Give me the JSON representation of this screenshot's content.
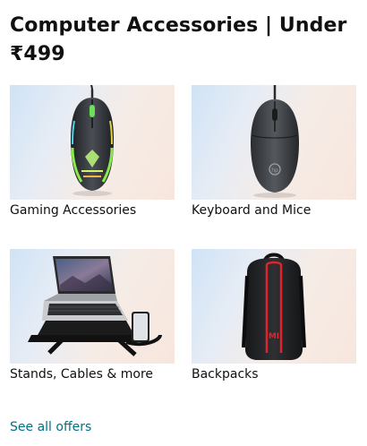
{
  "card": {
    "title": "Computer Accessories | Under ₹499",
    "tiles": [
      {
        "label": "Gaming Accessories",
        "image": "gaming-mouse-icon"
      },
      {
        "label": "Keyboard and Mice",
        "image": "mouse-icon"
      },
      {
        "label": "Stands, Cables & more",
        "image": "laptop-stand-icon"
      },
      {
        "label": "Backpacks",
        "image": "backpack-icon"
      }
    ],
    "see_all_label": "See all offers"
  },
  "colors": {
    "link": "#007185",
    "text": "#0f1111"
  }
}
